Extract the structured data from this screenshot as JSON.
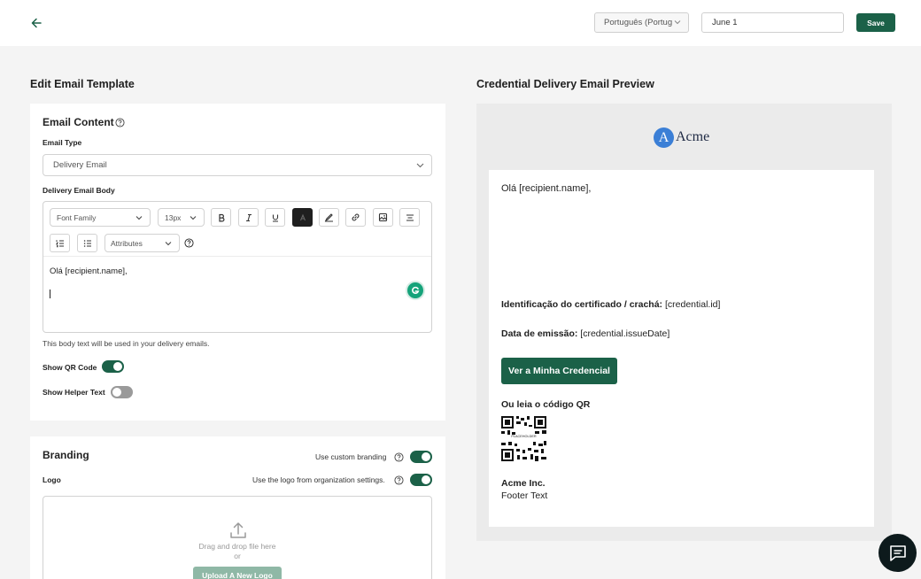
{
  "header": {
    "language_value": "Português (Portug",
    "date_value": "June 1",
    "save_label": "Save"
  },
  "editor": {
    "section_title": "Edit Email Template",
    "content": {
      "title": "Email Content",
      "email_type_label": "Email Type",
      "email_type_value": "Delivery Email",
      "body_label": "Delivery Email Body",
      "font_family_value": "Font Family",
      "font_size_value": "13px",
      "attributes_value": "Attributes",
      "body_text": "Olá [recipient.name],",
      "helper_text": "This body text will be used in your delivery emails.",
      "show_qr_label": "Show QR Code",
      "show_qr_on": true,
      "show_helper_label": "Show Helper Text",
      "show_helper_on": false
    },
    "branding": {
      "title": "Branding",
      "custom_branding_label": "Use custom branding",
      "logo_label": "Logo",
      "org_logo_label": "Use the logo from organization settings.",
      "drop_text": "Drag and drop file here",
      "or_text": "or",
      "upload_label": "Upload A New Logo"
    }
  },
  "preview": {
    "section_title": "Credential Delivery Email Preview",
    "logo_letter": "A",
    "logo_name": "Acme",
    "greeting": "Olá [recipient.name],",
    "id_label": "Identificação do certificado / crachá:",
    "id_value": "[credential.id]",
    "issue_label": "Data de emissão:",
    "issue_value": "[credential.issueDate]",
    "cta_label": "Ver a Minha Credencial",
    "qr_label": "Ou leia o código QR",
    "qr_placeholder": "PLACEHOLDER",
    "footer_company": "Acme Inc.",
    "footer_text": "Footer Text"
  },
  "icons": {
    "back": "arrow-left-icon",
    "chat": "chat-bubble-icon",
    "grammarly": "grammarly-icon"
  },
  "colors": {
    "primary": "#1b6148",
    "page_bg": "#f4f4f4",
    "preview_bg": "#ebebeb",
    "logo_blue": "#3b7fd6",
    "chat_bg": "#0d1a1c"
  }
}
